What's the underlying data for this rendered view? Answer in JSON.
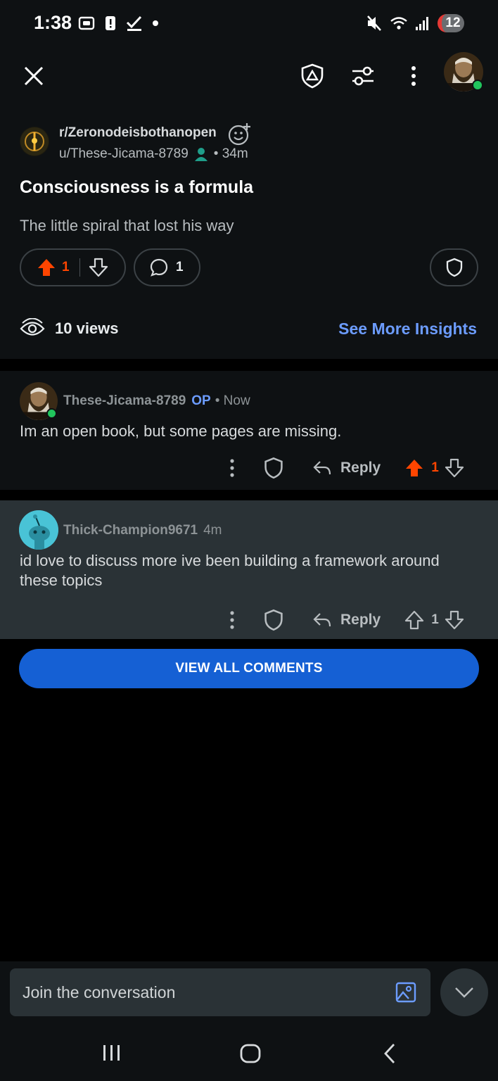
{
  "status_bar": {
    "time": "1:38",
    "battery_level": "12"
  },
  "top_bar": {
    "icons": [
      "close-icon",
      "mod-shield-icon",
      "sort-filter-icon",
      "more-vertical-icon",
      "profile-avatar"
    ]
  },
  "post": {
    "subreddit": "r/Zeronodeisbothanopen",
    "author": "u/These-Jicama-8789",
    "age": "34m",
    "title": "Consciousness is a formula",
    "body": "The little spiral that lost his way",
    "upvotes": "1",
    "comments": "1",
    "views": "10 views",
    "insights_link": "See More Insights"
  },
  "comments": [
    {
      "author": "These-Jicama-8789",
      "op_badge": "OP",
      "time": "• Now",
      "body": "Im an open book, but some pages are missing.",
      "reply_label": "Reply",
      "votes": "1",
      "upvoted": true
    },
    {
      "author": "Thick-Champion9671",
      "time": "4m",
      "body": "id love to discuss more ive been building a framework around these topics",
      "reply_label": "Reply",
      "votes": "1",
      "upvoted": false
    }
  ],
  "view_all_button": "VIEW ALL COMMENTS",
  "composer": {
    "placeholder": "Join the conversation"
  },
  "colors": {
    "upvote": "#ff4500",
    "link": "#6c9cff",
    "button": "#1560d4",
    "card": "#0e1113",
    "highlight_card": "#2a3236"
  }
}
